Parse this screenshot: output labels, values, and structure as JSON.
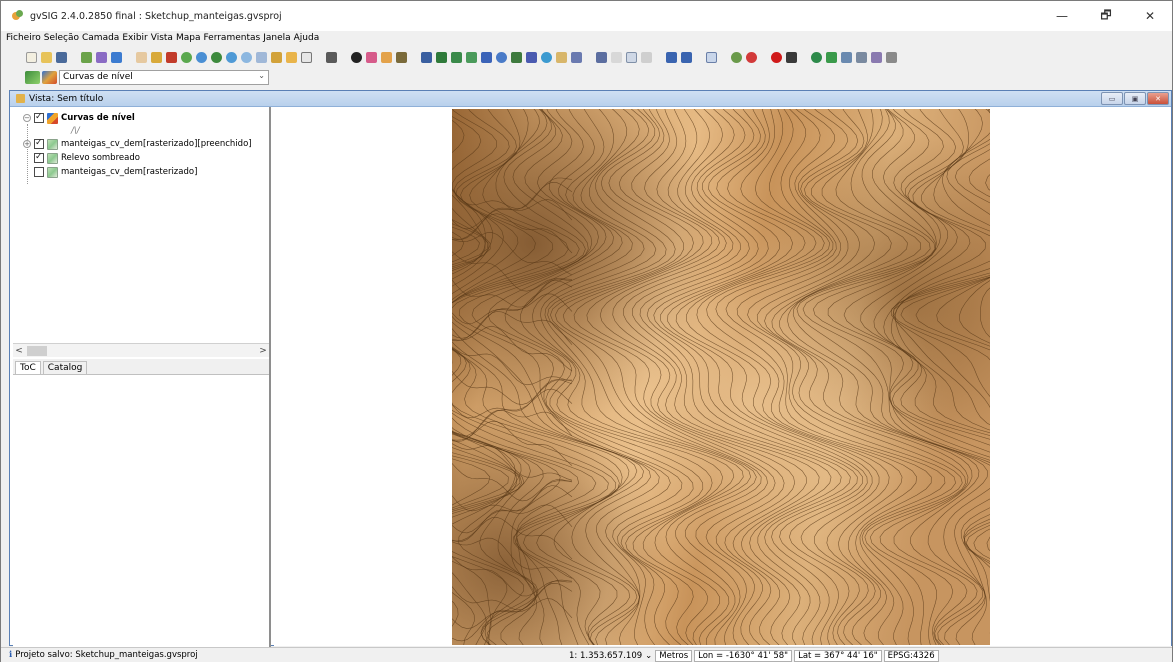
{
  "window": {
    "title": "gvSIG 2.4.0.2850 final : Sketchup_manteigas.gvsproj",
    "minimize_glyph": "—",
    "maximize_glyph": "🗗",
    "close_glyph": "✕"
  },
  "menubar": {
    "items": [
      "Ficheiro",
      "Seleção",
      "Camada",
      "Exibir",
      "Vista",
      "Mapa",
      "Ferramentas",
      "Janela",
      "Ajuda"
    ]
  },
  "layer_combo": {
    "value": "Curvas de nível",
    "arrow": "⌄"
  },
  "view": {
    "title": "Vista: Sem título",
    "btn_minimize": "▭",
    "btn_restore": "▣",
    "btn_close": "✕"
  },
  "toc": {
    "layers": [
      {
        "label": "Curvas de nível",
        "checked": true,
        "expanded": true
      },
      {
        "label": "manteigas_cv_dem[rasterizado][preenchido]",
        "checked": true,
        "expanded": false
      },
      {
        "label": "Relevo sombreado",
        "checked": true,
        "expanded": false
      },
      {
        "label": "manteigas_cv_dem[rasterizado]",
        "checked": false,
        "expanded": false
      }
    ],
    "legend_symbol": "/\\/",
    "scroll_left": "<",
    "scroll_right": ">",
    "tabs": [
      "ToC",
      "Catalog"
    ]
  },
  "statusbar": {
    "message": "Projeto salvo: Sketchup_manteigas.gvsproj",
    "scale": "1: 1.353.657.109",
    "scale_arrow": "⌄",
    "units": "Metros",
    "lon": "Lon = -1630° 41' 58\"",
    "lat": "Lat = 367° 44' 16\"",
    "crs": "EPSG:4326"
  },
  "colors": {
    "terrain_light": "#e3b47c",
    "terrain_dark": "#7d5429",
    "contour_line": "#5a3a18"
  }
}
